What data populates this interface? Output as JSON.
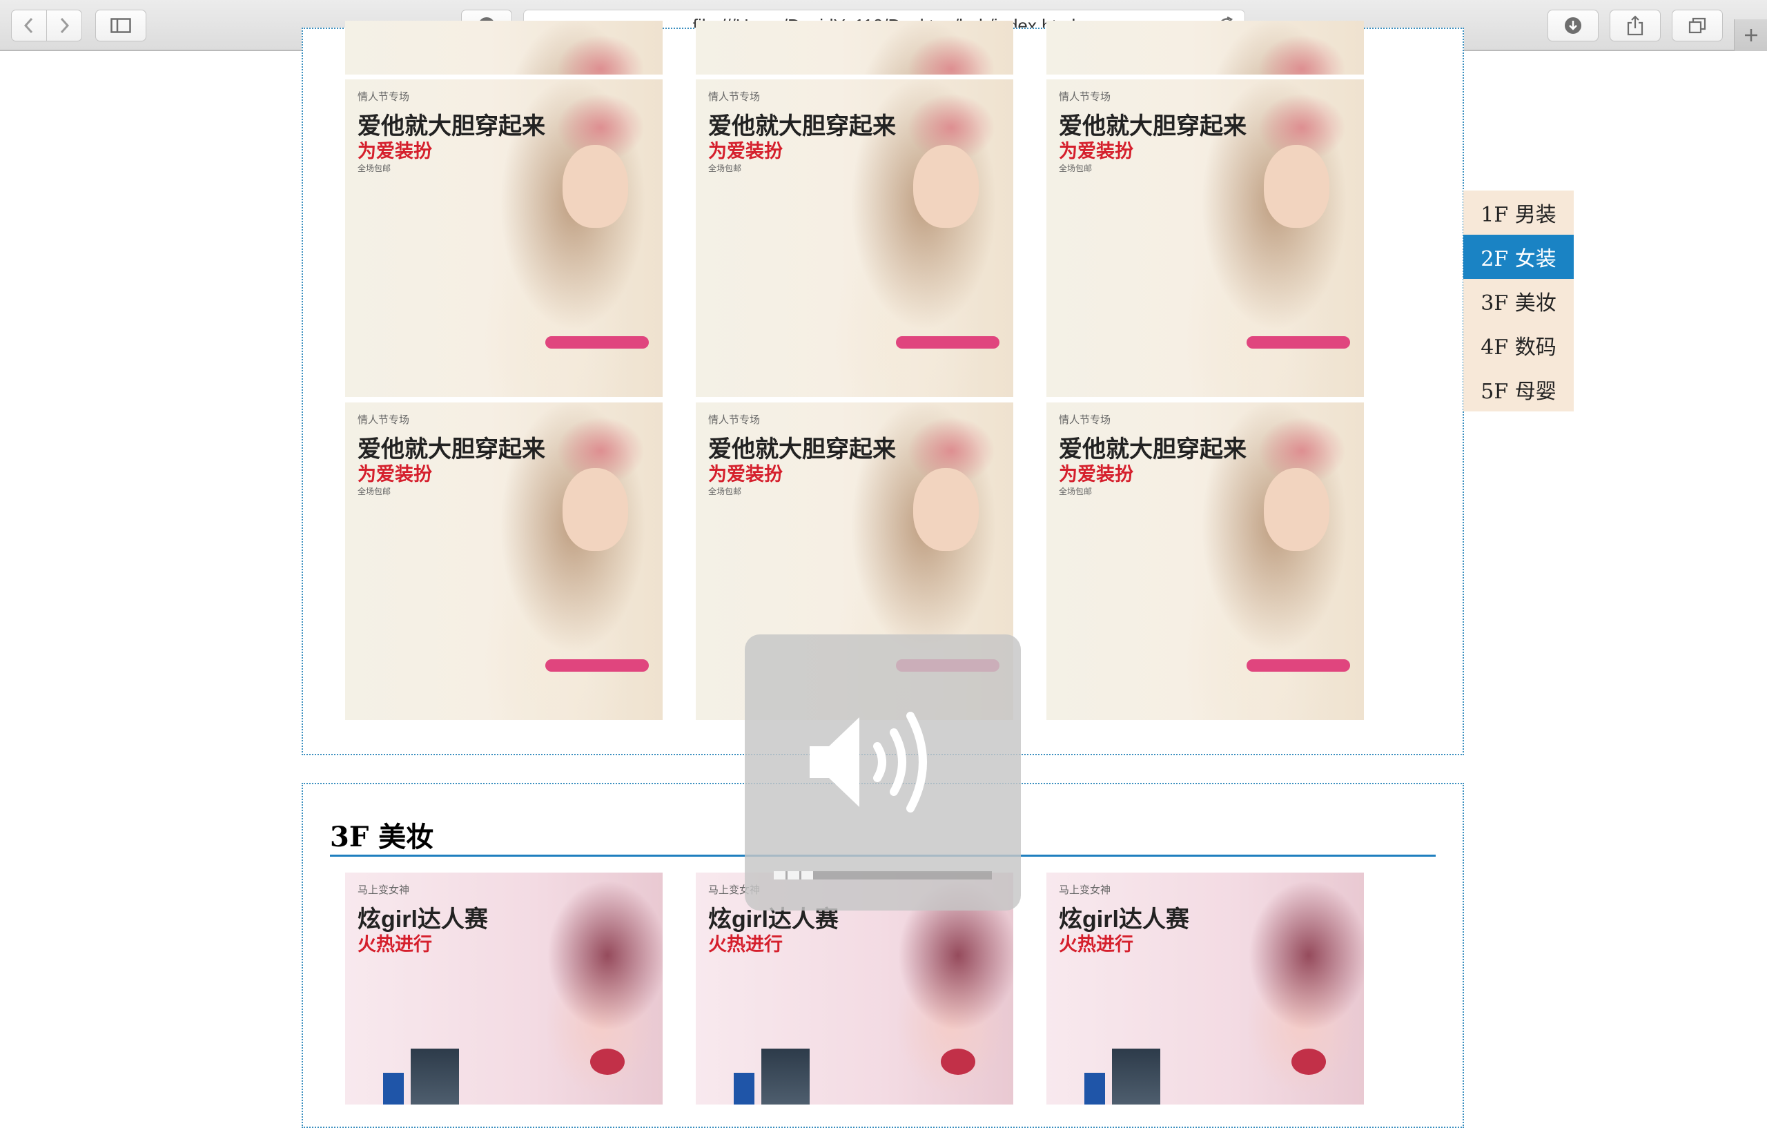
{
  "browser": {
    "url": "file:///Users/DavidYu110/Desktop/hah/index.html",
    "icons": [
      "back-icon",
      "forward-icon",
      "sidebar-icon",
      "privacy-icon",
      "reload-icon",
      "download-icon",
      "share-icon",
      "tabs-icon",
      "new-tab-icon"
    ]
  },
  "floor2": {
    "cards": [
      {
        "sub": "情人节专场",
        "title": "爱他就大胆穿起来",
        "accent": "为爱装扮",
        "note": "全场包邮"
      },
      {
        "sub": "情人节专场",
        "title": "爱他就大胆穿起来",
        "accent": "为爱装扮",
        "note": "全场包邮"
      },
      {
        "sub": "情人节专场",
        "title": "爱他就大胆穿起来",
        "accent": "为爱装扮",
        "note": "全场包邮"
      },
      {
        "sub": "情人节专场",
        "title": "爱他就大胆穿起来",
        "accent": "为爱装扮",
        "note": "全场包邮"
      },
      {
        "sub": "情人节专场",
        "title": "爱他就大胆穿起来",
        "accent": "为爱装扮",
        "note": "全场包邮"
      },
      {
        "sub": "情人节专场",
        "title": "爱他就大胆穿起来",
        "accent": "为爱装扮",
        "note": "全场包邮"
      }
    ]
  },
  "floor3": {
    "title": "3F 美妆",
    "cards": [
      {
        "sub": "马上变女神",
        "title": "炫girl达人赛",
        "accent": "火热进行"
      },
      {
        "sub": "马上变女神",
        "title": "炫girl达人赛",
        "accent": "火热进行"
      },
      {
        "sub": "马上变女神",
        "title": "炫girl达人赛",
        "accent": "火热进行"
      }
    ]
  },
  "floor_nav": {
    "items": [
      {
        "label": "1F 男装",
        "active": false
      },
      {
        "label": "2F 女装",
        "active": true
      },
      {
        "label": "3F 美妆",
        "active": false
      },
      {
        "label": "4F 数码",
        "active": false
      },
      {
        "label": "5F 母婴",
        "active": false
      }
    ]
  },
  "volume": {
    "level_fraction": 0.19
  },
  "colors": {
    "accent": "#1a83c4",
    "nav_bg": "#f7e8d8",
    "promo_red": "#d51f2c",
    "floor_border": "#3a8fbf"
  }
}
